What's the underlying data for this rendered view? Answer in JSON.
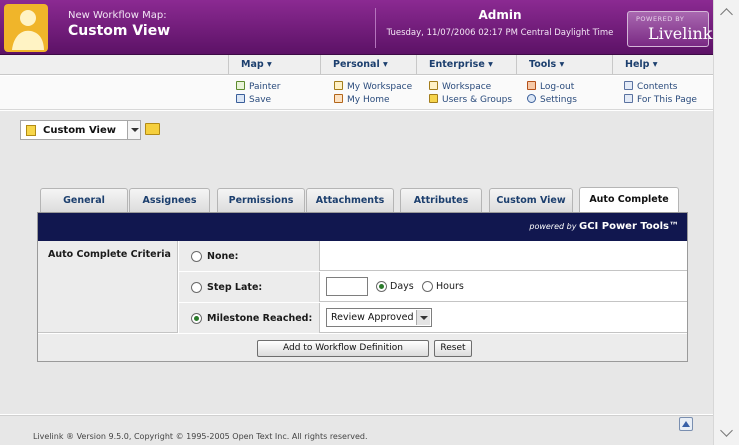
{
  "header": {
    "subtitle": "New Workflow Map:",
    "title": "Custom View",
    "user": "Admin",
    "datetime": "Tuesday, 11/07/2006 02:17 PM Central Daylight Time",
    "brand_powered": "POWERED BY",
    "brand_name": "Livelink"
  },
  "menus": [
    {
      "label": "Map ▾",
      "items": [
        "Painter",
        "Save"
      ]
    },
    {
      "label": "Personal ▾",
      "items": [
        "My Workspace",
        "My Home"
      ]
    },
    {
      "label": "Enterprise ▾",
      "items": [
        "Workspace",
        "Users & Groups"
      ]
    },
    {
      "label": "Tools ▾",
      "items": [
        "Log-out",
        "Settings"
      ]
    },
    {
      "label": "Help ▾",
      "items": [
        "Contents",
        "For This Page"
      ]
    }
  ],
  "toolbar": {
    "view_label": "Custom View"
  },
  "tabs": [
    {
      "label": "General"
    },
    {
      "label": "Assignees"
    },
    {
      "label": "Permissions"
    },
    {
      "label": "Attachments"
    },
    {
      "label": "Attributes"
    },
    {
      "label": "Custom View"
    },
    {
      "label": "Auto Complete"
    }
  ],
  "panel": {
    "powered_prefix": "powered by",
    "powered_brand": "GCI Power Tools™",
    "criteria_label": "Auto Complete Criteria",
    "options": {
      "none": "None:",
      "step_late": "Step Late:",
      "milestone": "Milestone Reached:"
    },
    "step_late_value": "",
    "unit_days": "Days",
    "unit_hours": "Hours",
    "milestone_selected": "Review Approved",
    "add_button": "Add to Workflow Definition",
    "reset_button": "Reset"
  },
  "footer": {
    "copyright": "Livelink ® Version 9.5.0, Copyright © 1995-2005 Open Text Inc. All rights reserved."
  }
}
